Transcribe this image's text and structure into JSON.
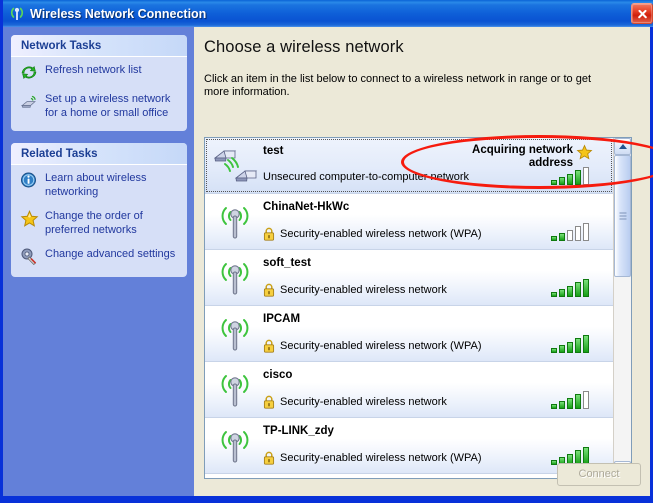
{
  "window": {
    "title": "Wireless Network Connection",
    "title_icon": "wireless-signal-icon",
    "close_label": "×",
    "titlebar_color": "#0a5fd8"
  },
  "sidebar": {
    "panels": [
      {
        "header": "Network Tasks",
        "tasks": [
          {
            "label": "Refresh network list",
            "icon": "refresh-icon"
          },
          {
            "label": "Set up a wireless network for a home or small office",
            "icon": "wireless-setup-icon"
          }
        ]
      },
      {
        "header": "Related Tasks",
        "tasks": [
          {
            "label": "Learn about wireless networking",
            "icon": "info-icon"
          },
          {
            "label": "Change the order of preferred networks",
            "icon": "star-icon"
          },
          {
            "label": "Change advanced settings",
            "icon": "wrench-icon"
          }
        ]
      }
    ]
  },
  "main": {
    "heading": "Choose a wireless network",
    "instruction": "Click an item in the list below to connect to a wireless network in range or to get more information.",
    "connect_button": "Connect",
    "connect_enabled": false,
    "networks": [
      {
        "ssid": "test",
        "security": "Unsecured computer-to-computer network",
        "secured": false,
        "icon": "adhoc-computer-to-computer-icon",
        "status": "Acquiring network address",
        "preferred": true,
        "selected": true,
        "signal_bars": 4,
        "signal_max": 5
      },
      {
        "ssid": "ChinaNet-HkWc",
        "security": "Security-enabled wireless network (WPA)",
        "secured": true,
        "icon": "access-point-icon",
        "status": "",
        "preferred": false,
        "selected": false,
        "signal_bars": 2,
        "signal_max": 5
      },
      {
        "ssid": "soft_test",
        "security": "Security-enabled wireless network",
        "secured": true,
        "icon": "access-point-icon",
        "status": "",
        "preferred": false,
        "selected": false,
        "signal_bars": 5,
        "signal_max": 5
      },
      {
        "ssid": "IPCAM",
        "security": "Security-enabled wireless network (WPA)",
        "secured": true,
        "icon": "access-point-icon",
        "status": "",
        "preferred": false,
        "selected": false,
        "signal_bars": 5,
        "signal_max": 5
      },
      {
        "ssid": "cisco",
        "security": "Security-enabled wireless network",
        "secured": true,
        "icon": "access-point-icon",
        "status": "",
        "preferred": false,
        "selected": false,
        "signal_bars": 4,
        "signal_max": 5
      },
      {
        "ssid": "TP-LINK_zdy",
        "security": "Security-enabled wireless network (WPA)",
        "secured": true,
        "icon": "access-point-icon",
        "status": "",
        "preferred": false,
        "selected": false,
        "signal_bars": 5,
        "signal_max": 5
      }
    ],
    "scrollbar": {
      "thumb_position_pct": 0,
      "thumb_size_pct": 40
    }
  },
  "annotation": {
    "shape": "ellipse",
    "color": "#f61b0e",
    "target": "test"
  }
}
